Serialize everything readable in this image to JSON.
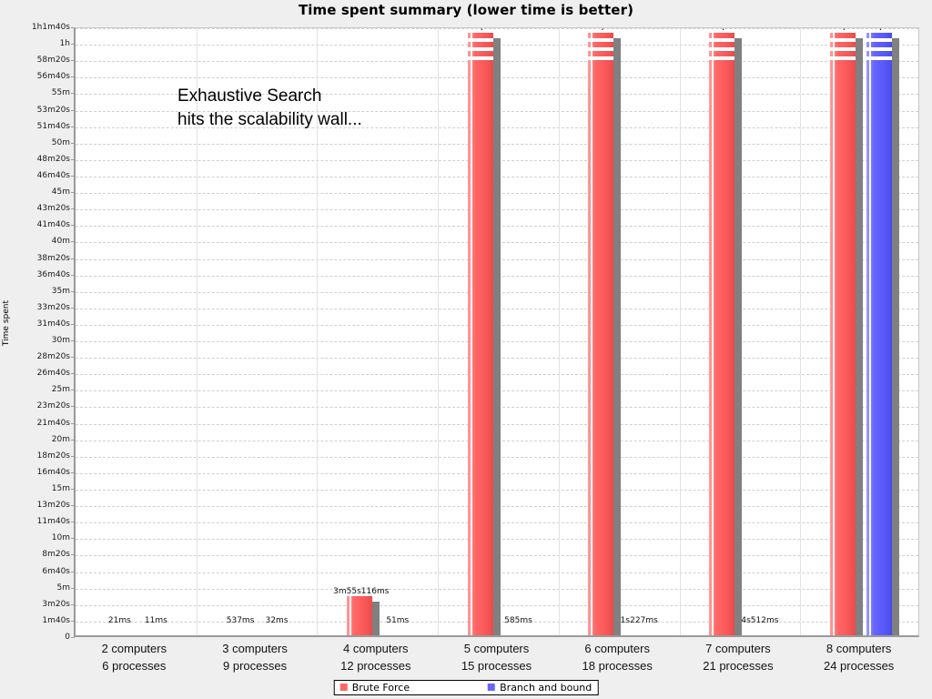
{
  "chart_data": {
    "type": "bar",
    "title": "Time spent summary (lower time is better)",
    "xlabel": "",
    "ylabel": "Time spent",
    "ylim": [
      0,
      3700
    ],
    "y_unit": "seconds",
    "grid": true,
    "legend_position": "bottom-center",
    "annotation": "Exhaustive Search\nhits the scalability wall...",
    "categories": [
      "2 computers\n6 processes",
      "3 computers\n9 processes",
      "4 computers\n12 processes",
      "5 computers\n15 processes",
      "6 computers\n18 processes",
      "7 computers\n21 processes",
      "8 computers\n24 processes"
    ],
    "category_lines": [
      [
        "2 computers",
        "6 processes"
      ],
      [
        "3 computers",
        "9 processes"
      ],
      [
        "4 computers",
        "12 processes"
      ],
      [
        "5 computers",
        "15 processes"
      ],
      [
        "6 computers",
        "18 processes"
      ],
      [
        "7 computers",
        "21 processes"
      ],
      [
        "8 computers",
        "24 processes"
      ]
    ],
    "series": [
      {
        "name": "Brute Force",
        "color": "#ff6666",
        "labels": [
          "21ms",
          "537ms",
          "3m55s116ms",
          "?",
          "?",
          "?",
          "?"
        ],
        "values": [
          0.021,
          0.537,
          235.116,
          3700,
          3700,
          3700,
          3700
        ],
        "clipped": [
          false,
          false,
          false,
          true,
          true,
          true,
          true
        ]
      },
      {
        "name": "Branch and bound",
        "color": "#6666ff",
        "labels": [
          "11ms",
          "32ms",
          "51ms",
          "585ms",
          "1s227ms",
          "4s512ms",
          "?"
        ],
        "values": [
          0.011,
          0.032,
          0.051,
          0.585,
          1.227,
          4.512,
          3700
        ],
        "clipped": [
          false,
          false,
          false,
          false,
          false,
          false,
          true
        ]
      }
    ],
    "ytick_labels": [
      "1h1m40s",
      "1h",
      "58m20s",
      "56m40s",
      "55m",
      "53m20s",
      "51m40s",
      "50m",
      "48m20s",
      "46m40s",
      "45m",
      "43m20s",
      "41m40s",
      "40m",
      "38m20s",
      "36m40s",
      "35m",
      "33m20s",
      "31m40s",
      "30m",
      "28m20s",
      "26m40s",
      "25m",
      "23m20s",
      "21m40s",
      "20m",
      "18m20s",
      "16m40s",
      "15m",
      "13m20s",
      "11m40s",
      "10m",
      "8m20s",
      "6m40s",
      "5m",
      "3m20s",
      "1m40s",
      "0"
    ],
    "ytick_values": [
      3700,
      3600,
      3500,
      3400,
      3300,
      3200,
      3100,
      3000,
      2900,
      2800,
      2700,
      2600,
      2500,
      2400,
      2300,
      2200,
      2100,
      2000,
      1900,
      1800,
      1700,
      1600,
      1500,
      1400,
      1300,
      1200,
      1100,
      1000,
      900,
      800,
      700,
      600,
      500,
      400,
      300,
      200,
      100,
      0
    ]
  },
  "legend": {
    "items": [
      {
        "label": "Brute Force",
        "color": "#ff6666"
      },
      {
        "label": "Branch and bound",
        "color": "#6666ff"
      }
    ]
  }
}
